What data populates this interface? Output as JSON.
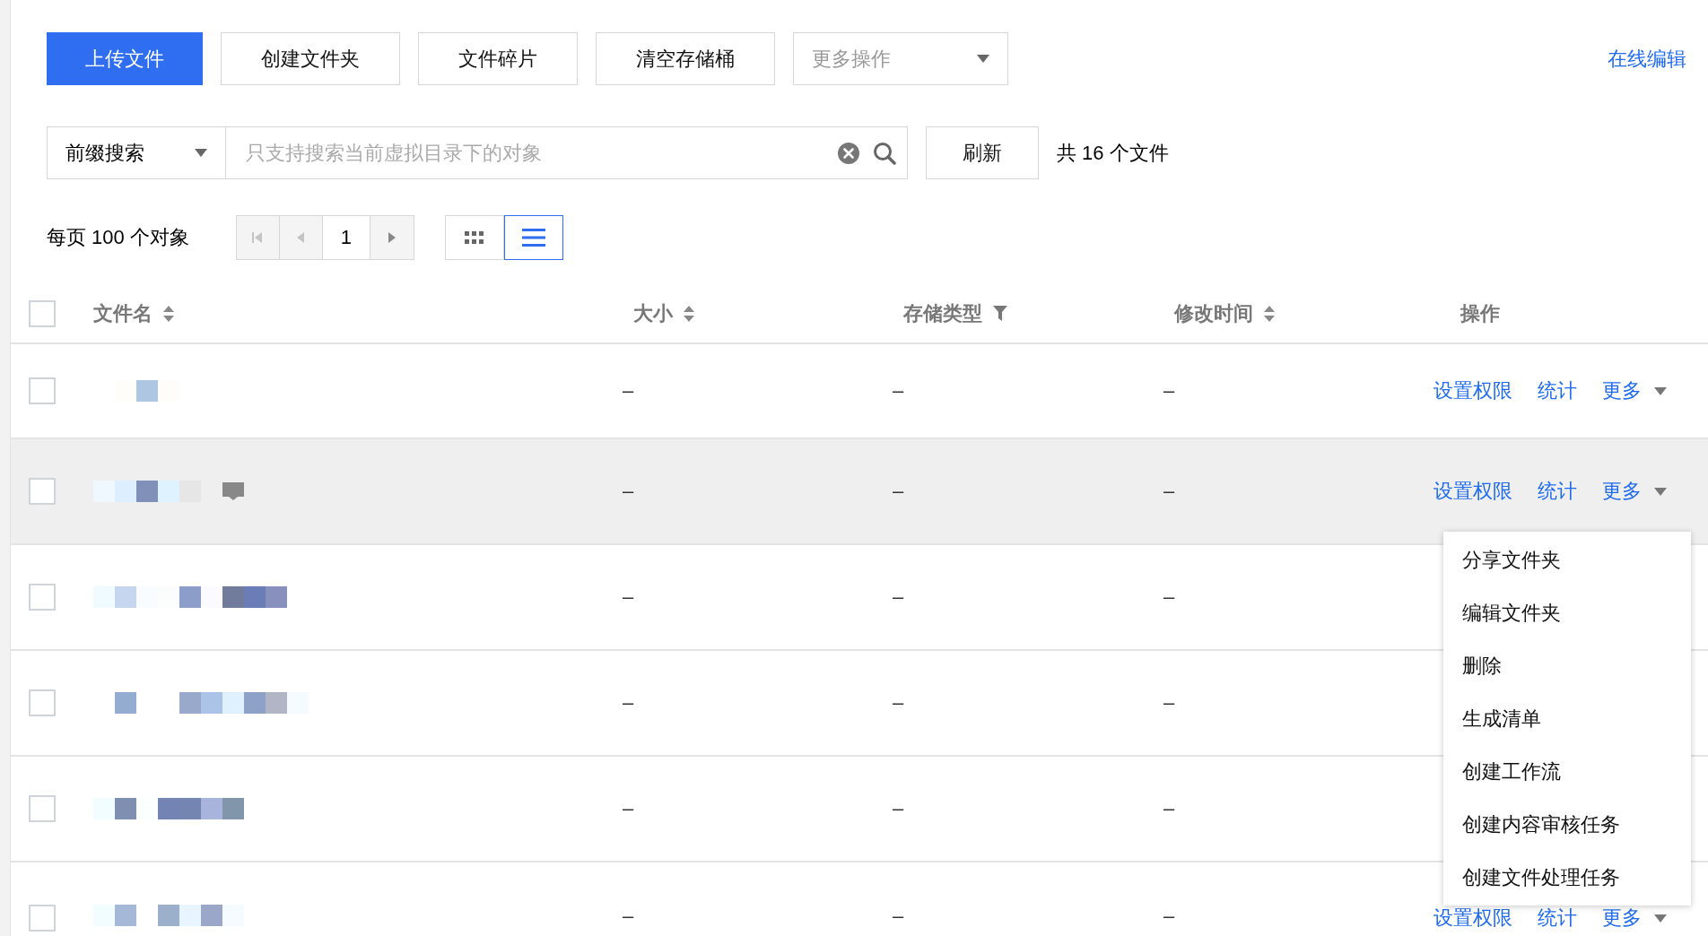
{
  "toolbar": {
    "buttons": [
      {
        "label": "上传文件",
        "kind": "primary"
      },
      {
        "label": "创建文件夹",
        "kind": "default"
      },
      {
        "label": "文件碎片",
        "kind": "default"
      },
      {
        "label": "清空存储桶",
        "kind": "default"
      },
      {
        "label": "更多操作",
        "kind": "select"
      }
    ],
    "editor_link": "在线编辑"
  },
  "search": {
    "mode": "前缀搜索",
    "placeholder": "只支持搜索当前虚拟目录下的对象",
    "refresh": "刷新",
    "count": "共 16 个文件"
  },
  "pager": {
    "page_size": "每页 100 个对象",
    "page": "1",
    "first_disabled": true,
    "prev_disabled": true,
    "next_disabled": false
  },
  "views": [
    {
      "kind": "grid",
      "selected": false
    },
    {
      "kind": "list",
      "selected": true
    }
  ],
  "table": {
    "select_all": {
      "checked": false
    },
    "columns": [
      {
        "label": "文件名",
        "kind": "sort"
      },
      {
        "label": "大小",
        "kind": "sort"
      },
      {
        "label": "存储类型",
        "kind": "filter"
      },
      {
        "label": "修改时间",
        "kind": "sort"
      },
      {
        "label": "操作",
        "kind": "plain"
      }
    ],
    "rows": [
      {
        "checked": false,
        "hovered": false,
        "tagged": false,
        "size": "–",
        "storage": "–",
        "modified": "–",
        "actions": [
          {
            "label": "设置权限",
            "kind": "link"
          },
          {
            "label": "统计",
            "kind": "link"
          },
          {
            "label": "更多",
            "kind": "dropdown"
          }
        ]
      },
      {
        "checked": false,
        "hovered": true,
        "tagged": true,
        "size": "–",
        "storage": "–",
        "modified": "–",
        "actions": [
          {
            "label": "设置权限",
            "kind": "link"
          },
          {
            "label": "统计",
            "kind": "link"
          },
          {
            "label": "更多",
            "kind": "dropdown"
          }
        ]
      },
      {
        "checked": false,
        "hovered": false,
        "tagged": false,
        "size": "–",
        "storage": "–",
        "modified": "–"
      },
      {
        "checked": false,
        "hovered": false,
        "tagged": false,
        "size": "–",
        "storage": "–",
        "modified": "–"
      },
      {
        "checked": false,
        "hovered": false,
        "tagged": false,
        "size": "–",
        "storage": "–",
        "modified": "–"
      },
      {
        "checked": false,
        "hovered": false,
        "tagged": false,
        "size": "–",
        "storage": "–",
        "modified": "–",
        "actions": [
          {
            "label": "设置权限",
            "kind": "link"
          },
          {
            "label": "统计",
            "kind": "link"
          },
          {
            "label": "更多",
            "kind": "dropdown"
          }
        ]
      }
    ]
  },
  "row_menu": {
    "items": [
      "分享文件夹",
      "编辑文件夹",
      "删除",
      "生成清单",
      "创建工作流",
      "创建内容审核任务",
      "创建文件处理任务"
    ]
  }
}
